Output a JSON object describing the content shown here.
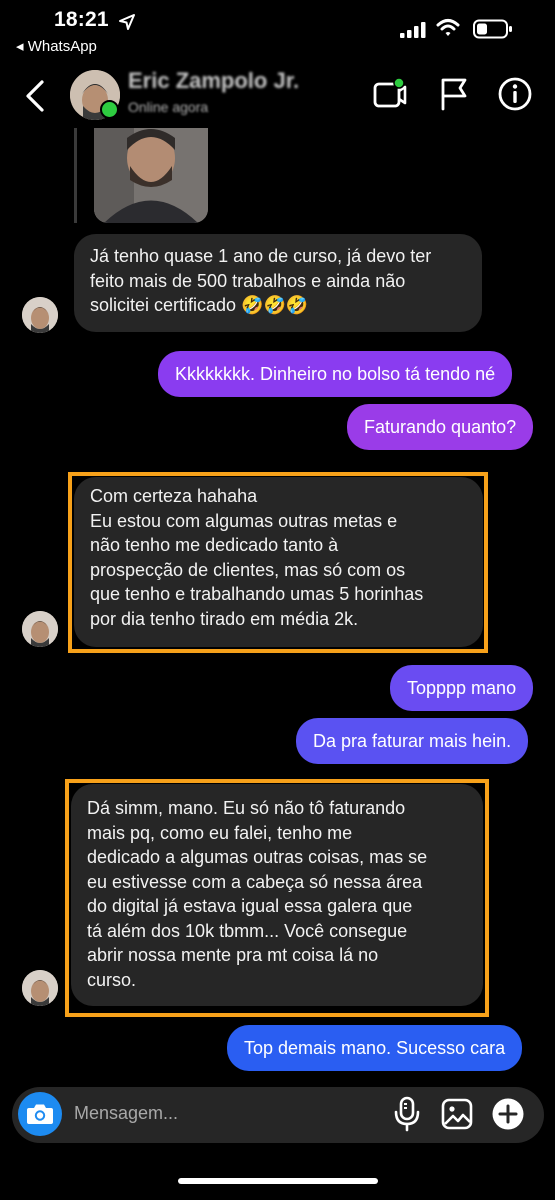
{
  "status_bar": {
    "time": "18:21",
    "back_app": "◂ WhatsApp"
  },
  "header": {
    "contact_name": "Eric Zampolo Jr.",
    "contact_status": "Online agora"
  },
  "messages": [
    {
      "kind": "received",
      "lines": [
        "Já tenho quase 1 ano de curso, já devo ter",
        "feito mais de 500 trabalhos e ainda não",
        "solicitei certificado 🤣🤣🤣"
      ]
    },
    {
      "kind": "sent",
      "text": "Kkkkkkkk. Dinheiro no bolso tá tendo né",
      "color": "#8a3cf0"
    },
    {
      "kind": "sent",
      "text": "Faturando quanto?",
      "color": "#9a3ce8"
    },
    {
      "kind": "received",
      "highlighted": true,
      "lines": [
        "Com certeza hahaha",
        "Eu estou com algumas outras metas e",
        "não tenho me dedicado tanto à",
        "prospecção de clientes, mas só com os",
        "que tenho e trabalhando umas 5 horinhas",
        "por dia tenho tirado em média 2k."
      ]
    },
    {
      "kind": "sent",
      "text": "Topppp mano",
      "color": "#6a4cf2"
    },
    {
      "kind": "sent",
      "text": "Da pra faturar mais hein.",
      "color": "#5a52f2"
    },
    {
      "kind": "received",
      "highlighted": true,
      "lines": [
        "Dá simm, mano. Eu só não tô faturando",
        "mais pq, como eu falei, tenho me",
        "dedicado a algumas outras coisas, mas se",
        "eu estivesse com a cabeça só nessa área",
        "do digital já estava igual essa galera que",
        "tá além dos 10k tbmm... Você consegue",
        "abrir nossa mente pra mt coisa lá no",
        "curso."
      ]
    },
    {
      "kind": "sent",
      "text": "Top demais mano. Sucesso cara",
      "color": "#2a5ef2"
    }
  ],
  "compose": {
    "placeholder": "Mensagem..."
  },
  "colors": {
    "accent_blue": "#1d8bf1",
    "highlight": "#f7a11a",
    "received_bubble": "#262626",
    "online": "#2ecc40"
  }
}
